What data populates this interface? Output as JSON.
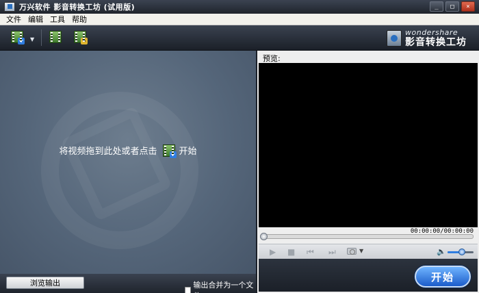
{
  "window": {
    "title": "万兴软件 影音转换工坊 (试用版)",
    "buttons": {
      "minimize": "_",
      "maximize": "□",
      "close": "×"
    }
  },
  "menu": {
    "items": [
      "文件",
      "编辑",
      "工具",
      "帮助"
    ]
  },
  "toolbar": {
    "add_video_icon": "add-video-icon",
    "dropdown_arrow": "▼",
    "buttons": [
      "add-file-icon",
      "edit-video-icon"
    ]
  },
  "brand": {
    "name_en": "wondershare",
    "name_cn": "影音转换工坊"
  },
  "drop_area": {
    "message_before": "将视频拖到此处或者点击",
    "message_after": "开始"
  },
  "left_bottom": {
    "browse_output": "浏览输出",
    "merge_label": "输出合并为一个文件",
    "merge_checked": false
  },
  "preview": {
    "label": "预览:",
    "timecode": "00:00:00/00:00:00",
    "progress": 0,
    "volume_fraction": 0.55,
    "controls": {
      "play": "▶",
      "stop": "■",
      "prev": "⏮",
      "next": "⏭",
      "camera_arrow": "▼",
      "volume": "🔈"
    }
  },
  "start_button": {
    "label": "开始"
  }
}
